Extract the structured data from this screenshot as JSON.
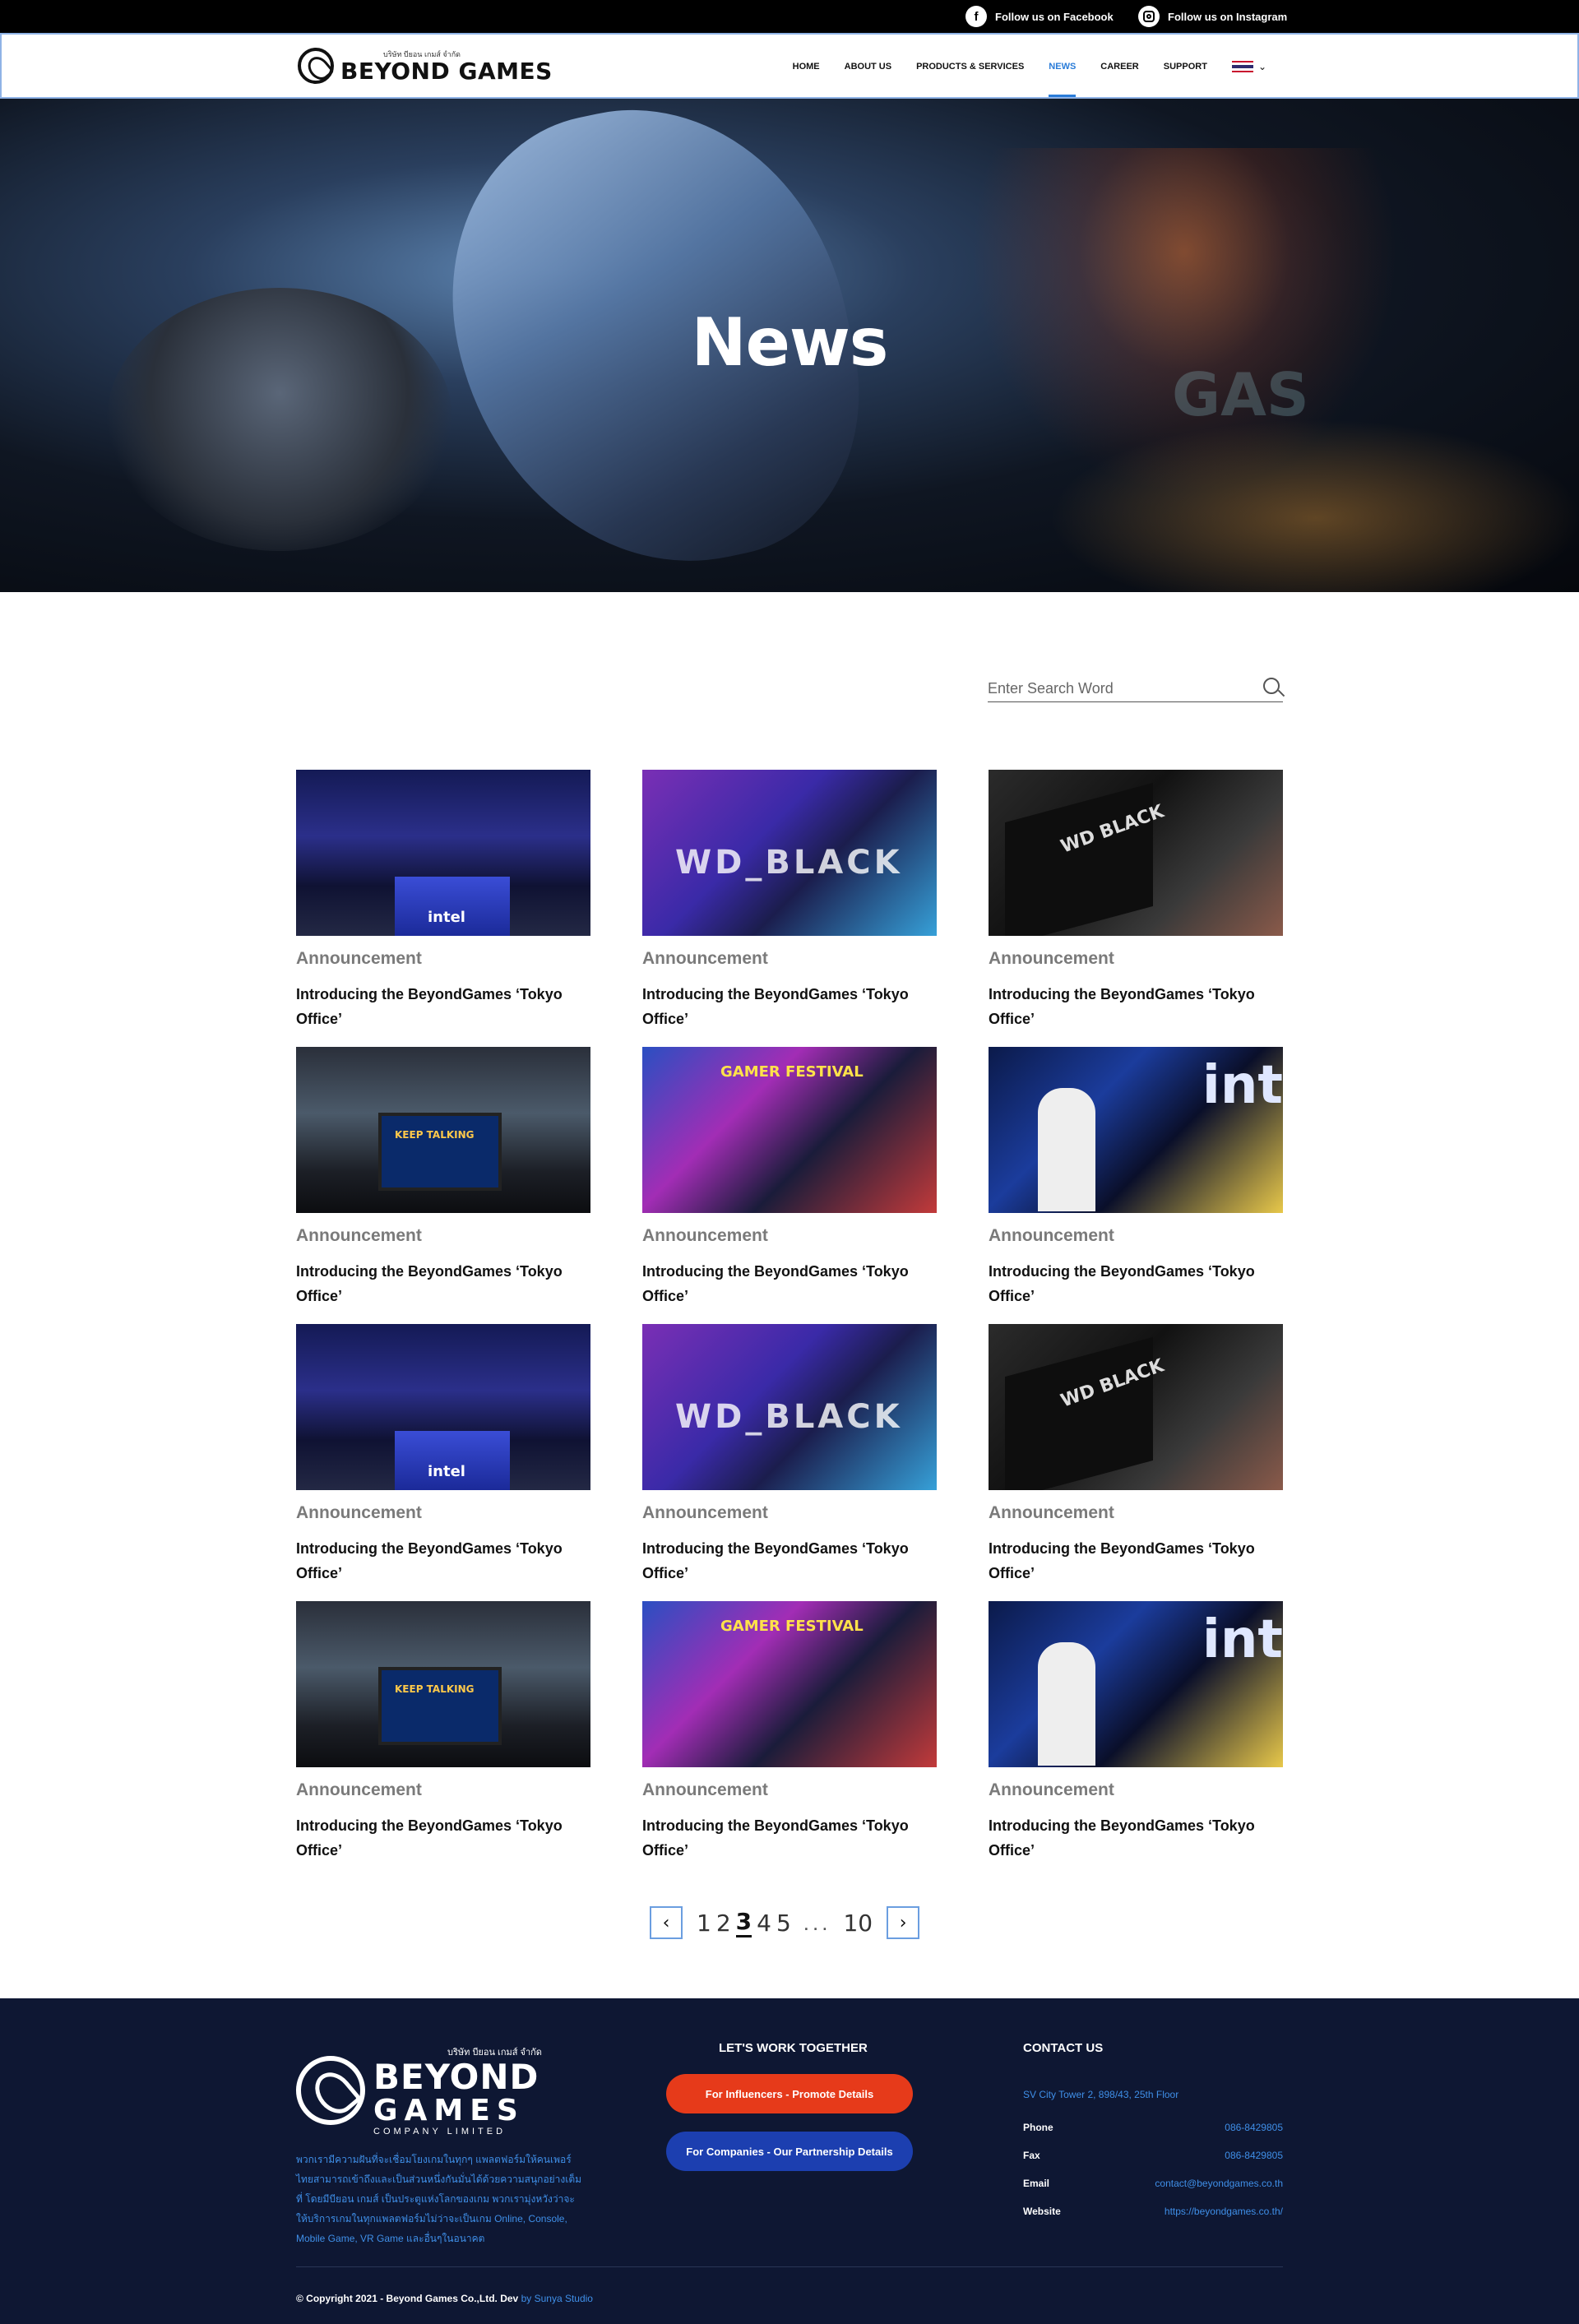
{
  "topbar": {
    "facebook_label": "Follow us on Facebook",
    "instagram_label": "Follow us on Instagram"
  },
  "header": {
    "logo_sub": "บริษัท บียอน เกมส์ จำกัด",
    "logo_name": "BEYOND GAMES",
    "nav": [
      {
        "label": "HOME"
      },
      {
        "label": "ABOUT US"
      },
      {
        "label": "PRODUCTS & SERVICES"
      },
      {
        "label": "NEWS",
        "active": true
      },
      {
        "label": "CAREER"
      },
      {
        "label": "SUPPORT"
      }
    ]
  },
  "hero": {
    "title": "News",
    "background_text": "GAS"
  },
  "search": {
    "placeholder": "Enter Search Word",
    "value": ""
  },
  "news": {
    "items": [
      {
        "category": "Announcement",
        "title": "Introducing the BeyondGames ‘Tokyo Office’",
        "thumb_text": "intel"
      },
      {
        "category": "Announcement",
        "title": "Introducing the BeyondGames ‘Tokyo Office’",
        "thumb_text": "WD_BLACK"
      },
      {
        "category": "Announcement",
        "title": "Introducing the BeyondGames ‘Tokyo Office’",
        "thumb_text": "WD BLACK"
      },
      {
        "category": "Announcement",
        "title": "Introducing the BeyondGames ‘Tokyo Office’",
        "thumb_text": "KEEP TALKING"
      },
      {
        "category": "Announcement",
        "title": "Introducing the BeyondGames ‘Tokyo Office’",
        "thumb_text": "GAMER FESTIVAL"
      },
      {
        "category": "Announcement",
        "title": "Introducing the BeyondGames ‘Tokyo Office’",
        "thumb_text": "int"
      },
      {
        "category": "Announcement",
        "title": "Introducing the BeyondGames ‘Tokyo Office’",
        "thumb_text": "intel"
      },
      {
        "category": "Announcement",
        "title": "Introducing the BeyondGames ‘Tokyo Office’",
        "thumb_text": "WD_BLACK"
      },
      {
        "category": "Announcement",
        "title": "Introducing the BeyondGames ‘Tokyo Office’",
        "thumb_text": "WD BLACK"
      },
      {
        "category": "Announcement",
        "title": "Introducing the BeyondGames ‘Tokyo Office’",
        "thumb_text": "KEEP TALKING"
      },
      {
        "category": "Announcement",
        "title": "Introducing the BeyondGames ‘Tokyo Office’",
        "thumb_text": "GAMER FESTIVAL"
      },
      {
        "category": "Announcement",
        "title": "Introducing the BeyondGames ‘Tokyo Office’",
        "thumb_text": "int"
      }
    ]
  },
  "pagination": {
    "pages": [
      "1",
      "2",
      "3",
      "4",
      "5"
    ],
    "current": "3",
    "ellipsis": "...",
    "last": "10",
    "prev_icon": "chevron-left-icon",
    "next_icon": "chevron-right-icon"
  },
  "footer": {
    "logo_sub": "บริษัท บียอน เกมส์ จำกัด",
    "logo_line1": "BEYOND",
    "logo_line2": "GAMES",
    "logo_company": "COMPANY LIMITED",
    "description": "พวกเรามีความฝันที่จะเชื่อมโยงเกมในทุกๆ แพลตฟอร์มให้คนเพอร์ไทยสามารถเข้าถึงและเป็นส่วนหนึ่งกันมั่นได้ด้วยความสนุกอย่างเต็มที่ โดยมีบียอน เกมส์ เป็นประตูแห่งโลกของเกม พวกเรามุ่งหวังว่าจะให้บริการเกมในทุกแพลตฟอร์มไม่ว่าจะเป็นเกม Online, Console, Mobile Game, VR Game และอื่นๆในอนาคต",
    "work_title": "LET'S WORK TOGETHER",
    "btn_influencers": "For Influencers - Promote Details",
    "btn_companies": "For Companies - Our Partnership Details",
    "contact_title": "CONTACT US",
    "address": "SV City Tower 2, 898/43, 25th Floor",
    "contacts": [
      {
        "key": "Phone",
        "value": "086-8429805"
      },
      {
        "key": "Fax",
        "value": "086-8429805"
      },
      {
        "key": "Email",
        "value": "contact@beyondgames.co.th"
      },
      {
        "key": "Website",
        "value": "https://beyondgames.co.th/"
      }
    ],
    "copyright": "© Copyright 2021 - Beyond Games Co.,Ltd. Dev",
    "dev_by": "by Sunya Studio"
  },
  "colors": {
    "accent": "#2a7cd8",
    "footer_bg": "#0e1733",
    "btn_red": "#e63a1a",
    "btn_blue": "#1c3fb0",
    "category_gray": "#7a7a7a"
  }
}
